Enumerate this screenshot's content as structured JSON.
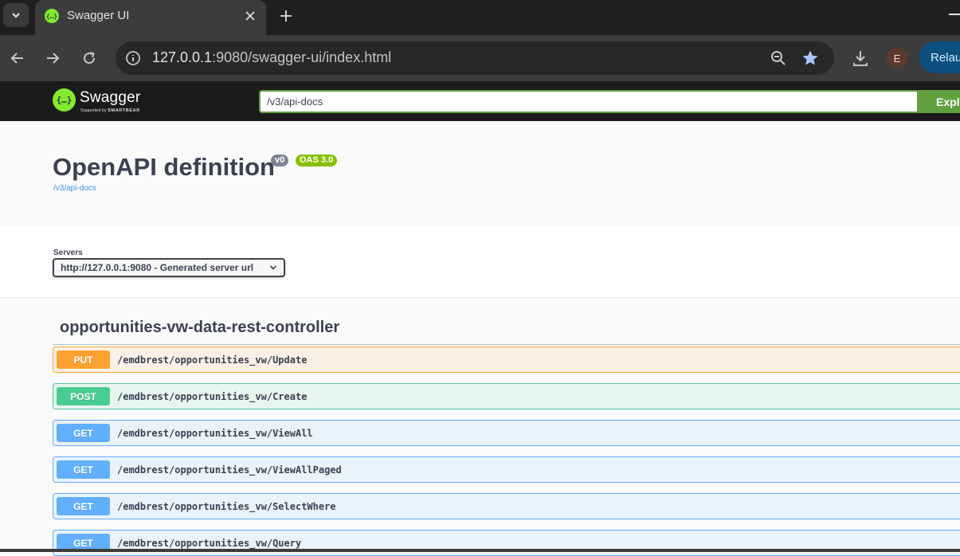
{
  "browser": {
    "tab_title": "Swagger UI",
    "url_host": "127.0.0.1",
    "url_rest": ":9080/swagger-ui/index.html",
    "profile_initial": "E",
    "relaunch_label": "Relaunch"
  },
  "swagger": {
    "logo_word": "Swagger",
    "logo_sub_prefix": "Supported by",
    "logo_sub_brand": "SMARTBEAR",
    "spec_url": "/v3/api-docs",
    "explore_label": "Explore"
  },
  "info": {
    "title": "OpenAPI definition",
    "version_badge": "v0",
    "oas_badge": "OAS 3.0",
    "link": "/v3/api-docs"
  },
  "servers": {
    "label": "Servers",
    "selected": "http://127.0.0.1:9080 - Generated server url"
  },
  "tag": {
    "name": "opportunities-vw-data-rest-controller"
  },
  "operations": [
    {
      "method": "PUT",
      "path": "/emdbrest/opportunities_vw/Update"
    },
    {
      "method": "POST",
      "path": "/emdbrest/opportunities_vw/Create"
    },
    {
      "method": "GET",
      "path": "/emdbrest/opportunities_vw/ViewAll"
    },
    {
      "method": "GET",
      "path": "/emdbrest/opportunities_vw/ViewAllPaged"
    },
    {
      "method": "GET",
      "path": "/emdbrest/opportunities_vw/SelectWhere"
    },
    {
      "method": "GET",
      "path": "/emdbrest/opportunities_vw/Query"
    }
  ],
  "colors": {
    "put": "#fca130",
    "post": "#49cc90",
    "get": "#61affe",
    "swagger_green": "#85ea2d",
    "explore_green": "#62a03f"
  }
}
